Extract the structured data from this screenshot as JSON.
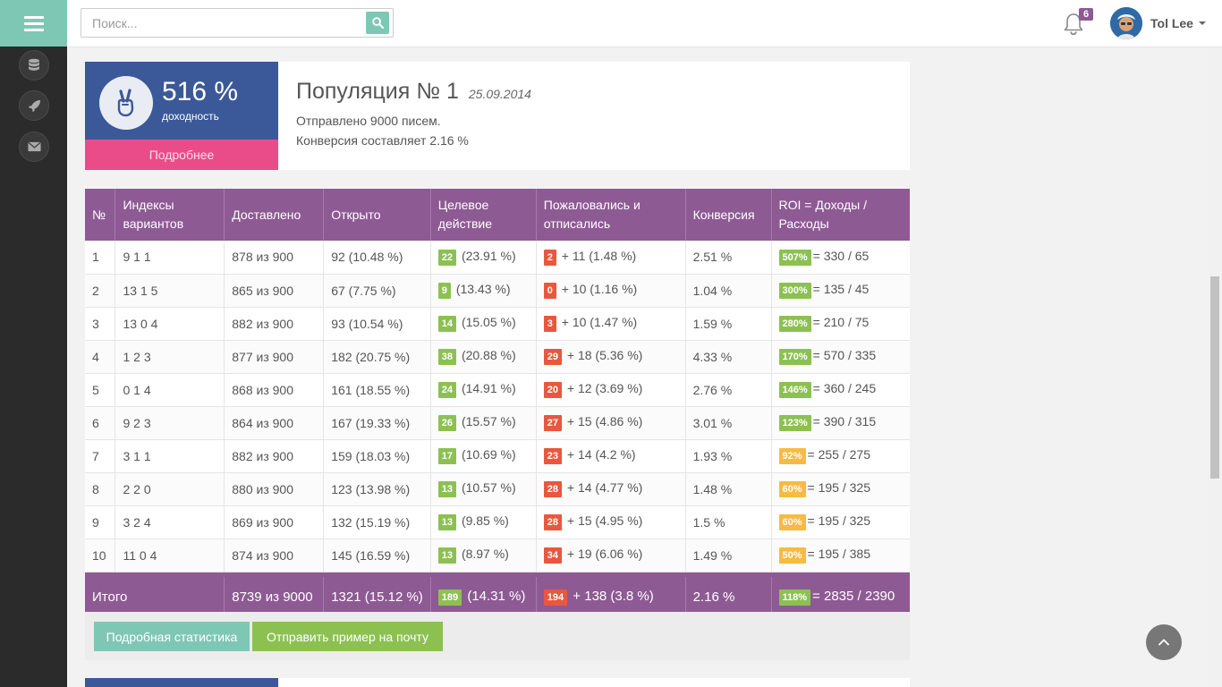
{
  "header": {
    "search_placeholder": "Поиск...",
    "notifications_count": "6",
    "user_name": "Tol Lee"
  },
  "sidebar": {
    "icons": [
      "database-icon",
      "rocket-icon",
      "envelope-icon"
    ]
  },
  "population": {
    "percent": "516 %",
    "percent_label": "доходность",
    "more_label": "Подробнее",
    "title": "Популяция № 1",
    "date": "25.09.2014",
    "sent_text": "Отправлено 9000 писем.",
    "conversion_text": "Конверсия составляет 2.16 %"
  },
  "table": {
    "headers": [
      "№",
      "Индексы вариантов",
      "Доставлено",
      "Открыто",
      "Целевое действие",
      "Пожаловались и отписались",
      "Конверсия",
      "ROI = Доходы / Расходы"
    ],
    "rows": [
      {
        "n": "1",
        "idx": "9 1 1",
        "delivered": "878 из 900",
        "opened": "92 (10.48 %)",
        "target_badge": "22",
        "target_pct": "(23.91 %)",
        "complain_badge": "2",
        "complain_rest": "+ 11 (1.48 %)",
        "conv": "2.51 %",
        "roi_badge": "507%",
        "roi_color": "green",
        "roi_rest": "= 330 / 65"
      },
      {
        "n": "2",
        "idx": "13 1 5",
        "delivered": "865 из 900",
        "opened": "67 (7.75 %)",
        "target_badge": "9",
        "target_pct": "(13.43 %)",
        "complain_badge": "0",
        "complain_rest": "+ 10 (1.16 %)",
        "conv": "1.04 %",
        "roi_badge": "300%",
        "roi_color": "green",
        "roi_rest": "= 135 / 45"
      },
      {
        "n": "3",
        "idx": "13 0 4",
        "delivered": "882 из 900",
        "opened": "93 (10.54 %)",
        "target_badge": "14",
        "target_pct": "(15.05 %)",
        "complain_badge": "3",
        "complain_rest": "+ 10 (1.47 %)",
        "conv": "1.59 %",
        "roi_badge": "280%",
        "roi_color": "green",
        "roi_rest": "= 210 / 75"
      },
      {
        "n": "4",
        "idx": "1 2 3",
        "delivered": "877 из 900",
        "opened": "182 (20.75 %)",
        "target_badge": "38",
        "target_pct": "(20.88 %)",
        "complain_badge": "29",
        "complain_rest": "+ 18 (5.36 %)",
        "conv": "4.33 %",
        "roi_badge": "170%",
        "roi_color": "green",
        "roi_rest": "= 570 / 335"
      },
      {
        "n": "5",
        "idx": "0 1 4",
        "delivered": "868 из 900",
        "opened": "161 (18.55 %)",
        "target_badge": "24",
        "target_pct": "(14.91 %)",
        "complain_badge": "20",
        "complain_rest": "+ 12 (3.69 %)",
        "conv": "2.76 %",
        "roi_badge": "146%",
        "roi_color": "green",
        "roi_rest": "= 360 / 245"
      },
      {
        "n": "6",
        "idx": "9 2 3",
        "delivered": "864 из 900",
        "opened": "167 (19.33 %)",
        "target_badge": "26",
        "target_pct": "(15.57 %)",
        "complain_badge": "27",
        "complain_rest": "+ 15 (4.86 %)",
        "conv": "3.01 %",
        "roi_badge": "123%",
        "roi_color": "green",
        "roi_rest": "= 390 / 315"
      },
      {
        "n": "7",
        "idx": "3 1 1",
        "delivered": "882 из 900",
        "opened": "159 (18.03 %)",
        "target_badge": "17",
        "target_pct": "(10.69 %)",
        "complain_badge": "23",
        "complain_rest": "+ 14 (4.2 %)",
        "conv": "1.93 %",
        "roi_badge": "92%",
        "roi_color": "orange",
        "roi_rest": "= 255 / 275"
      },
      {
        "n": "8",
        "idx": "2 2 0",
        "delivered": "880 из 900",
        "opened": "123 (13.98 %)",
        "target_badge": "13",
        "target_pct": "(10.57 %)",
        "complain_badge": "28",
        "complain_rest": "+ 14 (4.77 %)",
        "conv": "1.48 %",
        "roi_badge": "60%",
        "roi_color": "orange",
        "roi_rest": "= 195 / 325"
      },
      {
        "n": "9",
        "idx": "3 2 4",
        "delivered": "869 из 900",
        "opened": "132 (15.19 %)",
        "target_badge": "13",
        "target_pct": "(9.85 %)",
        "complain_badge": "28",
        "complain_rest": "+ 15 (4.95 %)",
        "conv": "1.5 %",
        "roi_badge": "60%",
        "roi_color": "orange",
        "roi_rest": "= 195 / 325"
      },
      {
        "n": "10",
        "idx": "11 0 4",
        "delivered": "874 из 900",
        "opened": "145 (16.59 %)",
        "target_badge": "13",
        "target_pct": "(8.97 %)",
        "complain_badge": "34",
        "complain_rest": "+ 19 (6.06 %)",
        "conv": "1.49 %",
        "roi_badge": "50%",
        "roi_color": "orange",
        "roi_rest": "= 195 / 385"
      }
    ],
    "total": {
      "label": "Итого",
      "delivered": "8739 из 9000",
      "opened": "1321 (15.12 %)",
      "target_badge": "189",
      "target_pct": "(14.31 %)",
      "complain_badge": "194",
      "complain_rest": "+ 138 (3.8 %)",
      "conv": "2.16 %",
      "roi_badge": "118%",
      "roi_rest": "= 2835 / 2390"
    }
  },
  "buttons": {
    "stats_label": "Подробная статистика",
    "mail_label": "Отправить пример на почту"
  },
  "colors": {
    "accent_teal": "#7fc7b5",
    "header_purple": "#8e5a94",
    "stat_blue": "#3b5998",
    "pink": "#ea4c89",
    "green": "#8cc152",
    "red": "#e9573f",
    "orange": "#f6bb42"
  }
}
